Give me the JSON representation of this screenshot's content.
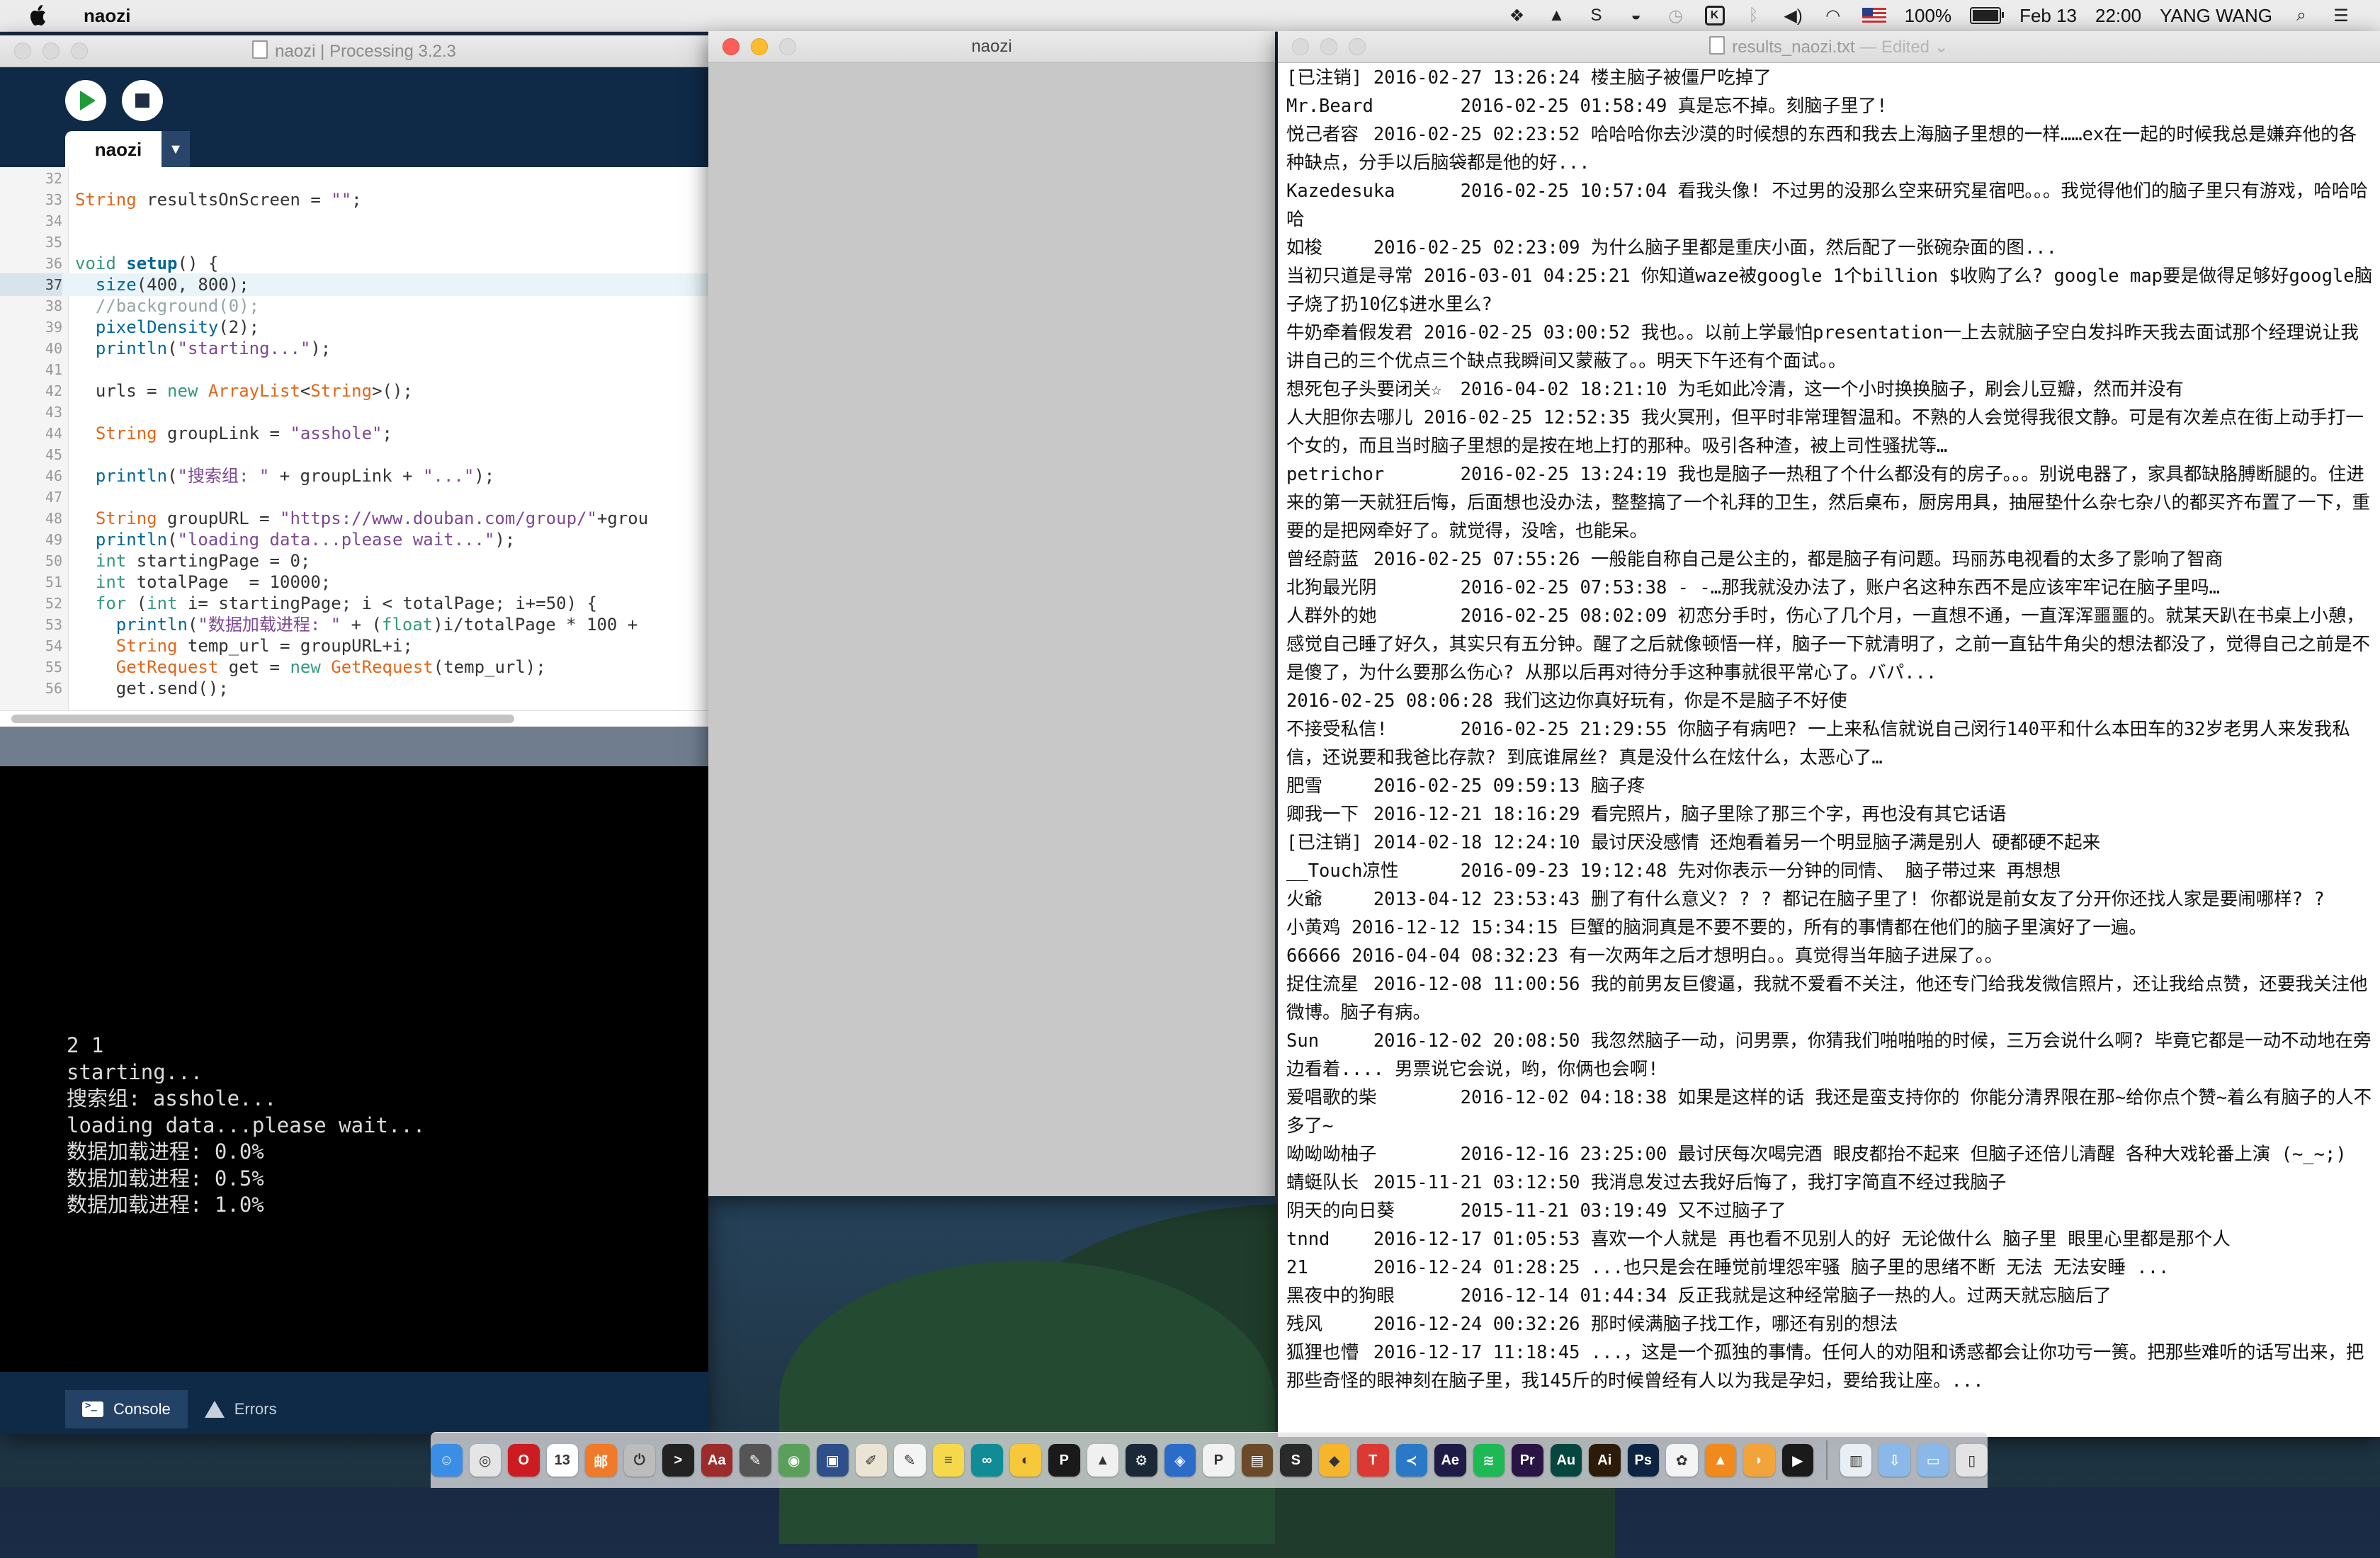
{
  "menubar": {
    "app_name": "naozi",
    "battery_percent": "100%",
    "date": "Feb 13",
    "time": "22:00",
    "user": "YANG WANG",
    "status_icons": [
      "dropbox-icon",
      "drive-icon",
      "s-icon",
      "toggle-icon",
      "timemachine-icon",
      "box-icon",
      "bluetooth-icon",
      "volume-icon",
      "wifi-icon",
      "us-flag-icon",
      "battery-icon"
    ]
  },
  "ide": {
    "title": "naozi | Processing 3.2.3",
    "tab_label": "naozi",
    "tab_menu": "▼",
    "code_lines": [
      {
        "n": "32",
        "html": ""
      },
      {
        "n": "33",
        "html": "<span class=\"ty\">String</span> resultsOnScreen = <span class=\"str\">\"\"</span>;"
      },
      {
        "n": "34",
        "html": ""
      },
      {
        "n": "35",
        "html": ""
      },
      {
        "n": "36",
        "html": "<span class=\"kw\">void</span> <span class=\"fn\"><b>setup</b></span>() {"
      },
      {
        "n": "37",
        "html": "  <span class=\"fn\">size</span>(400, 800);",
        "highlight": true
      },
      {
        "n": "38",
        "html": "  <span class=\"cm\">//background(0);</span>"
      },
      {
        "n": "39",
        "html": "  <span class=\"fn\">pixelDensity</span>(2);"
      },
      {
        "n": "40",
        "html": "  <span class=\"fn\">println</span>(<span class=\"str\">\"starting...\"</span>);"
      },
      {
        "n": "41",
        "html": ""
      },
      {
        "n": "42",
        "html": "  urls = <span class=\"kw\">new</span> <span class=\"ty\">ArrayList</span>&lt;<span class=\"ty\">String</span>&gt;();"
      },
      {
        "n": "43",
        "html": ""
      },
      {
        "n": "44",
        "html": "  <span class=\"ty\">String</span> groupLink = <span class=\"str\">\"asshole\"</span>;"
      },
      {
        "n": "45",
        "html": ""
      },
      {
        "n": "46",
        "html": "  <span class=\"fn\">println</span>(<span class=\"str\">\"搜索组: \"</span> + groupLink + <span class=\"str\">\"...\"</span>);"
      },
      {
        "n": "47",
        "html": ""
      },
      {
        "n": "48",
        "html": "  <span class=\"ty\">String</span> groupURL = <span class=\"str\">\"https://www.douban.com/group/\"</span>+grou"
      },
      {
        "n": "49",
        "html": "  <span class=\"fn\">println</span>(<span class=\"str\">\"loading data...please wait...\"</span>);"
      },
      {
        "n": "50",
        "html": "  <span class=\"kw\">int</span> startingPage = 0;"
      },
      {
        "n": "51",
        "html": "  <span class=\"kw\">int</span> totalPage  = 10000;"
      },
      {
        "n": "52",
        "html": "  <span class=\"kw\">for</span> (<span class=\"kw\">int</span> i= startingPage; i &lt; totalPage; i+=50) {"
      },
      {
        "n": "53",
        "html": "    <span class=\"fn\">println</span>(<span class=\"str\">\"数据加载进程: \"</span> + (<span class=\"kw\">float</span>)i/totalPage * 100 +"
      },
      {
        "n": "54",
        "html": "    <span class=\"ty\">String</span> temp_url = groupURL+i;"
      },
      {
        "n": "55",
        "html": "    <span class=\"ty\">GetRequest</span> get = <span class=\"kw\">new</span> <span class=\"ty\">GetRequest</span>(temp_url);"
      },
      {
        "n": "56",
        "html": "    get.send();"
      }
    ],
    "console_lines": [
      "2 1",
      "starting...",
      "搜索组: asshole...",
      "loading data...please wait...",
      "数据加载进程: 0.0%",
      "数据加载进程: 0.5%",
      "数据加载进程: 1.0%"
    ],
    "console_tab": "Console",
    "errors_tab": "Errors"
  },
  "sketch": {
    "title": "naozi"
  },
  "textedit": {
    "title": "results_naozi.txt",
    "edited": "— Edited ⌄",
    "entries": [
      "[已注销]\t2016-02-27 13:26:24 楼主脑子被僵尸吃掉了",
      "Mr.Beard\t2016-02-25 01:58:49 真是忘不掉。刻脑子里了!",
      "悦己者容\t2016-02-25 02:23:52 哈哈哈你去沙漠的时候想的东西和我去上海脑子里想的一样……ex在一起的时候我总是嫌弃他的各种缺点，分手以后脑袋都是他的好...",
      "Kazedesuka\t2016-02-25 10:57:04 看我头像! 不过男的没那么空来研究星宿吧。。。我觉得他们的脑子里只有游戏，哈哈哈哈",
      "如梭\t2016-02-25 02:23:09 为什么脑子里都是重庆小面，然后配了一张碗杂面的图...",
      "当初只道是寻常 2016-03-01 04:25:21 你知道waze被google 1个billion $收购了么? google map要是做得足够好google脑子烧了扔10亿$进水里么?",
      "牛奶牵着假发君 2016-02-25 03:00:52 我也。。以前上学最怕presentation一上去就脑子空白发抖昨天我去面试那个经理说让我讲自己的三个优点三个缺点我瞬间又蒙蔽了。。明天下午还有个面试。。",
      "想死包子头要闭关☆\t2016-04-02 18:21:10 为毛如此冷清，这一个小时换换脑子，刷会儿豆瓣，然而并没有",
      "人大胆你去哪儿 2016-02-25 12:52:35 我火冥刑，但平时非常理智温和。不熟的人会觉得我很文静。可是有次差点在街上动手打一个女的，而且当时脑子里想的是按在地上打的那种。吸引各种渣，被上司性骚扰等…",
      "petrichor\t2016-02-25 13:24:19 我也是脑子一热租了个什么都没有的房子。。。别说电器了，家具都缺胳膊断腿的。住进来的第一天就狂后悔，后面想也没办法，整整搞了一个礼拜的卫生，然后桌布，厨房用具，抽屉垫什么杂七杂八的都买齐布置了一下，重要的是把网牵好了。就觉得，没啥，也能呆。",
      "曾经蔚蓝\t2016-02-25 07:55:26 一般能自称自己是公主的，都是脑子有问题。玛丽苏电视看的太多了影响了智商",
      "北狗最光阴\t2016-02-25 07:53:38 - -…那我就没办法了，账户名这种东西不是应该牢牢记在脑子里吗…",
      "人群外的她\t2016-02-25 08:02:09 初恋分手时，伤心了几个月，一直想不通，一直浑浑噩噩的。就某天趴在书桌上小憩，感觉自己睡了好久，其实只有五分钟。醒了之后就像顿悟一样，脑子一下就清明了，之前一直钻牛角尖的想法都没了，觉得自己之前是不是傻了，为什么要那么伤心? 从那以后再对待分手这种事就很平常心了。バパ...",
      "2016-02-25 08:06:28 我们这边你真好玩有，你是不是脑子不好使",
      "不接受私信!\t2016-02-25 21:29:55 你脑子有病吧? 一上来私信就说自己闵行140平和什么本田车的32岁老男人来发我私信，还说要和我爸比存款? 到底谁屌丝? 真是没什么在炫什么，太恶心了…",
      "肥雪\t2016-02-25 09:59:13 脑子疼",
      "卿我一下\t2016-12-21 18:16:29 看完照片，脑子里除了那三个字，再也没有其它话语",
      "[已注销]\t2014-02-18 12:24:10 最讨厌没感情 还炮看着另一个明显脑子满是别人 硬都硬不起来",
      "__Touch凉性\t2016-09-23 19:12:48 先对你表示一分钟的同情、 脑子带过来 再想想",
      "火爺\t2013-04-12 23:53:43 删了有什么意义? ? ? 都记在脑子里了! 你都说是前女友了分开你还找人家是要闹哪样? ?",
      "小黄鸡 2016-12-12 15:34:15 巨蟹的脑洞真是不要不要的，所有的事情都在他们的脑子里演好了一遍。",
      "66666 2016-04-04 08:32:23 有一次两年之后才想明白。。真觉得当年脑子进屎了。。",
      "捉住流星\t2016-12-08 11:00:56 我的前男友巨傻逼，我就不爱看不关注，他还专门给我发微信照片，还让我给点赞，还要我关注他微博。脑子有病。",
      "Sun\t2016-12-02 20:08:50 我忽然脑子一动，问男票，你猜我们啪啪啪的时候，三万会说什么啊? 毕竟它都是一动不动地在旁边看着.... 男票说它会说，哟，你俩也会啊!",
      "爱唱歌的柴\t2016-12-02 04:18:38 如果是这样的话 我还是蛮支持你的 你能分清界限在那~给你点个赞~着么有脑子的人不多了~",
      "呦呦呦柚子\t2016-12-16 23:25:00 最讨厌每次喝完酒 眼皮都抬不起来 但脑子还倍儿清醒 各种大戏轮番上演 (~_~;)",
      "蜻蜓队长\t2015-11-21 03:12:50 我消息发过去我好后悔了，我打字简直不经过我脑子",
      "阴天的向日葵\t2015-11-21 03:19:49 又不过脑子了",
      "tnnd\t2016-12-17 01:05:53 喜欢一个人就是 再也看不见别人的好 无论做什么 脑子里 眼里心里都是那个人",
      "21\t2016-12-24 01:28:25 ...也只是会在睡觉前埋怨牢骚 脑子里的思绪不断 无法 无法安睡 ...",
      "黑夜中的狗眼\t2016-12-14 01:44:34 反正我就是这种经常脑子一热的人。过两天就忘脑后了",
      "残风\t2016-12-24 00:32:26 那时候满脑子找工作，哪还有别的想法",
      "狐狸也懵\t2016-12-17 11:18:45 ...，这是一个孤独的事情。任何人的劝阻和诱惑都会让你功亏一篑。把那些难听的话写出来，把那些奇怪的眼神刻在脑子里，我145斤的时候曾经有人以为我是孕妇，要给我让座。..."
    ]
  },
  "dock": {
    "apps": [
      {
        "name": "finder-icon",
        "color": "#3a8ee6",
        "glyph": "☺"
      },
      {
        "name": "chrome-icon",
        "color": "#e5e5e5",
        "glyph": "◎"
      },
      {
        "name": "opera-icon",
        "color": "#cc1b21",
        "glyph": "O"
      },
      {
        "name": "calendar-icon",
        "color": "#ffffff",
        "glyph": "13"
      },
      {
        "name": "app-icon-orange",
        "color": "#f07a2a",
        "glyph": "邮"
      },
      {
        "name": "timer-icon",
        "color": "#bcbcbc",
        "glyph": "⏻"
      },
      {
        "name": "terminal-icon",
        "color": "#222222",
        "glyph": ">"
      },
      {
        "name": "dictionary-icon",
        "color": "#9c2b2b",
        "glyph": "Aa"
      },
      {
        "name": "brush-icon",
        "color": "#555555",
        "glyph": "✎"
      },
      {
        "name": "sphere-icon",
        "color": "#5aa05a",
        "glyph": "◉"
      },
      {
        "name": "window-icon",
        "color": "#2d4f8a",
        "glyph": "▣"
      },
      {
        "name": "drawing-icon",
        "color": "#e9e4d4",
        "glyph": "✐"
      },
      {
        "name": "paper-icon",
        "color": "#f4f4f4",
        "glyph": "✎"
      },
      {
        "name": "notes-icon",
        "color": "#f5d94a",
        "glyph": "≡"
      },
      {
        "name": "arduino-icon",
        "color": "#0f8c95",
        "glyph": "∞"
      },
      {
        "name": "duck-icon",
        "color": "#f6c83a",
        "glyph": "◐"
      },
      {
        "name": "processing-icon",
        "color": "#1a1a1a",
        "glyph": "P"
      },
      {
        "name": "drive-icon",
        "color": "#f0f0f0",
        "glyph": "▲"
      },
      {
        "name": "steam-icon",
        "color": "#1b2838",
        "glyph": "⚙"
      },
      {
        "name": "sourcetree-icon",
        "color": "#2b6cc8",
        "glyph": "◈"
      },
      {
        "name": "p-icon",
        "color": "#f2f2f2",
        "glyph": "P"
      },
      {
        "name": "clapper-icon",
        "color": "#6b4a2a",
        "glyph": "▤"
      },
      {
        "name": "scrivener-icon",
        "color": "#2a2a2a",
        "glyph": "S"
      },
      {
        "name": "sketch-icon",
        "color": "#f7b52c",
        "glyph": "◆"
      },
      {
        "name": "todo-icon",
        "color": "#db3a34",
        "glyph": "T"
      },
      {
        "name": "vscode-icon",
        "color": "#2b79c6",
        "glyph": "≺"
      },
      {
        "name": "ae-icon",
        "color": "#1f1b47",
        "glyph": "Ae"
      },
      {
        "name": "spotify-icon",
        "color": "#1db954",
        "glyph": "≋"
      },
      {
        "name": "pr-icon",
        "color": "#2a1445",
        "glyph": "Pr"
      },
      {
        "name": "au-icon",
        "color": "#05463f",
        "glyph": "Au"
      },
      {
        "name": "ai-icon",
        "color": "#2c1b08",
        "glyph": "Ai"
      },
      {
        "name": "ps-icon",
        "color": "#0c2441",
        "glyph": "Ps"
      },
      {
        "name": "photos-icon",
        "color": "#f4f4f4",
        "glyph": "✿"
      },
      {
        "name": "vlc-icon",
        "color": "#f08a1c",
        "glyph": "▲"
      },
      {
        "name": "squirrel-icon",
        "color": "#f2a33a",
        "glyph": "◗"
      },
      {
        "name": "quicktime-icon",
        "color": "#1a1a1a",
        "glyph": "▶"
      },
      {
        "name": "preview-icon",
        "color": "#e9eef5",
        "glyph": "▥"
      },
      {
        "name": "downloads-folder-icon",
        "color": "#8ab8e8",
        "glyph": "⇩"
      },
      {
        "name": "documents-folder-icon",
        "color": "#8ab8e8",
        "glyph": "▭"
      },
      {
        "name": "trash-icon",
        "color": "#e3e3e3",
        "glyph": "▯"
      }
    ]
  }
}
